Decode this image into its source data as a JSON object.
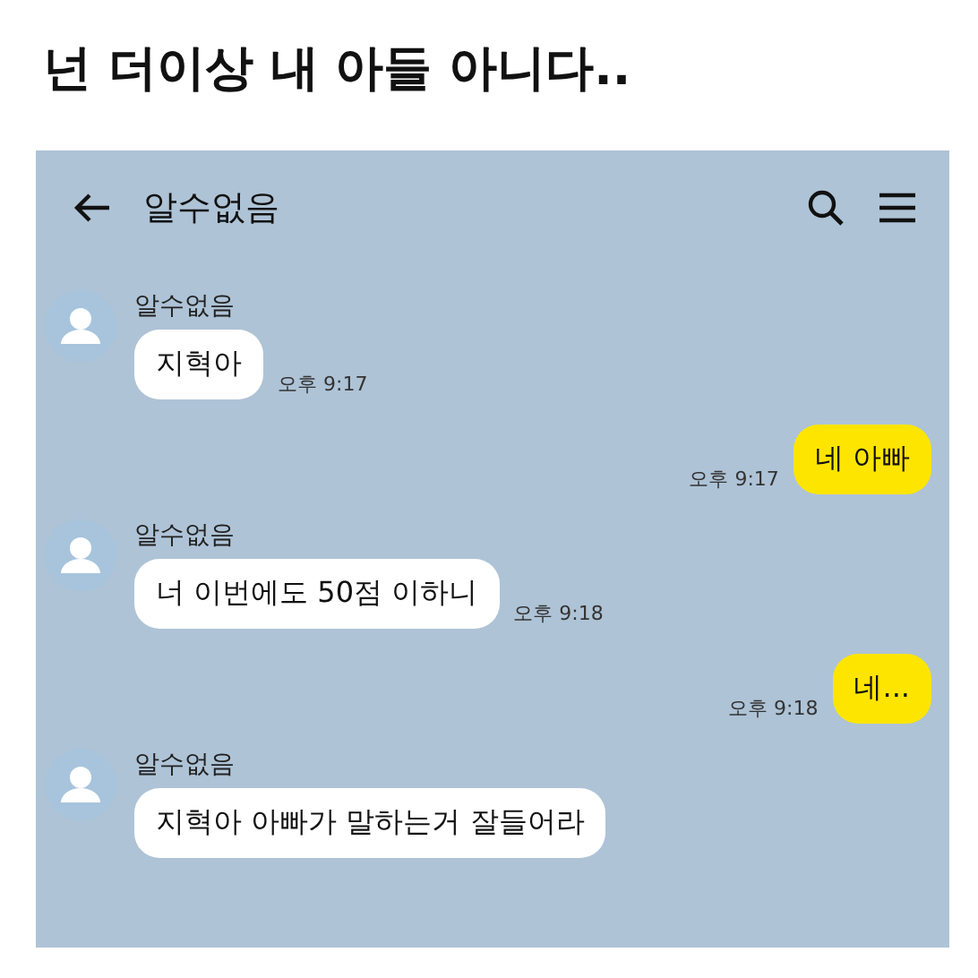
{
  "headline": "넌 더이상 내 아들 아니다..",
  "chat": {
    "header": {
      "title": "알수없음"
    },
    "messages": [
      {
        "kind": "received",
        "sender": "알수없음",
        "text": "지혁아",
        "time": "오후 9:17"
      },
      {
        "kind": "sent",
        "text": "네 아빠",
        "time": "오후 9:17"
      },
      {
        "kind": "received",
        "sender": "알수없음",
        "text": "너 이번에도 50점 이하니",
        "time": "오후 9:18"
      },
      {
        "kind": "sent",
        "text": "네...",
        "time": "오후 9:18"
      },
      {
        "kind": "received",
        "sender": "알수없음",
        "text": "지혁아 아빠가 말하는거 잘들어라"
      }
    ]
  }
}
